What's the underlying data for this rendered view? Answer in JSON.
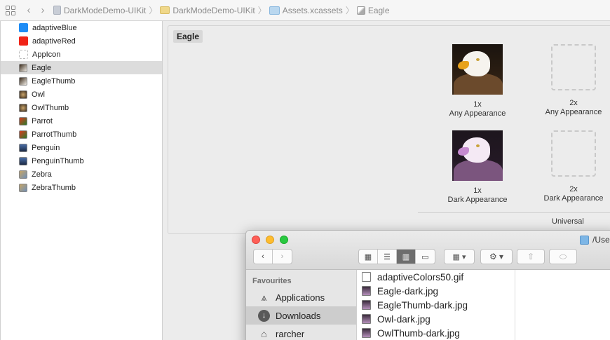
{
  "jumpbar": {
    "crumbs": [
      "DarkModeDemo-UIKit",
      "DarkModeDemo-UIKit",
      "Assets.xcassets",
      "Eagle"
    ]
  },
  "assets": [
    {
      "name": "adaptiveBlue",
      "kind": "color",
      "color": "#1e8cf5"
    },
    {
      "name": "adaptiveRed",
      "kind": "color",
      "color": "#f02418"
    },
    {
      "name": "AppIcon",
      "kind": "appicon"
    },
    {
      "name": "Eagle",
      "kind": "image",
      "selected": true
    },
    {
      "name": "EagleThumb",
      "kind": "image"
    },
    {
      "name": "Owl",
      "kind": "image"
    },
    {
      "name": "OwlThumb",
      "kind": "image"
    },
    {
      "name": "Parrot",
      "kind": "image"
    },
    {
      "name": "ParrotThumb",
      "kind": "image"
    },
    {
      "name": "Penguin",
      "kind": "image"
    },
    {
      "name": "PenguinThumb",
      "kind": "image"
    },
    {
      "name": "Zebra",
      "kind": "image"
    },
    {
      "name": "ZebraThumb",
      "kind": "image"
    }
  ],
  "editor": {
    "set_name": "Eagle",
    "slots": [
      {
        "scale": "1x",
        "appearance": "Any Appearance",
        "filled": true
      },
      {
        "scale": "2x",
        "appearance": "Any Appearance",
        "filled": false
      },
      {
        "scale": "1x",
        "appearance": "Dark Appearance",
        "filled": true
      },
      {
        "scale": "2x",
        "appearance": "Dark Appearance",
        "filled": false
      }
    ],
    "footer_label": "Universal"
  },
  "finder": {
    "path_title": "/Use",
    "sidebar": {
      "section": "Favourites",
      "items": [
        {
          "label": "Applications",
          "icon": "applications-icon"
        },
        {
          "label": "Downloads",
          "icon": "downloads-icon",
          "selected": true
        },
        {
          "label": "rarcher",
          "icon": "home-icon"
        }
      ]
    },
    "files": [
      {
        "name": "adaptiveColors50.gif",
        "type": "doc"
      },
      {
        "name": "Eagle-dark.jpg",
        "type": "pic"
      },
      {
        "name": "EagleThumb-dark.jpg",
        "type": "pic"
      },
      {
        "name": "Owl-dark.jpg",
        "type": "pic"
      },
      {
        "name": "OwlThumb-dark.jpg",
        "type": "pic"
      }
    ]
  },
  "colors": {
    "traffic_close": "#fe5f57",
    "traffic_min": "#febc2e",
    "traffic_max": "#28c840",
    "selection": "#dcdcdc"
  }
}
